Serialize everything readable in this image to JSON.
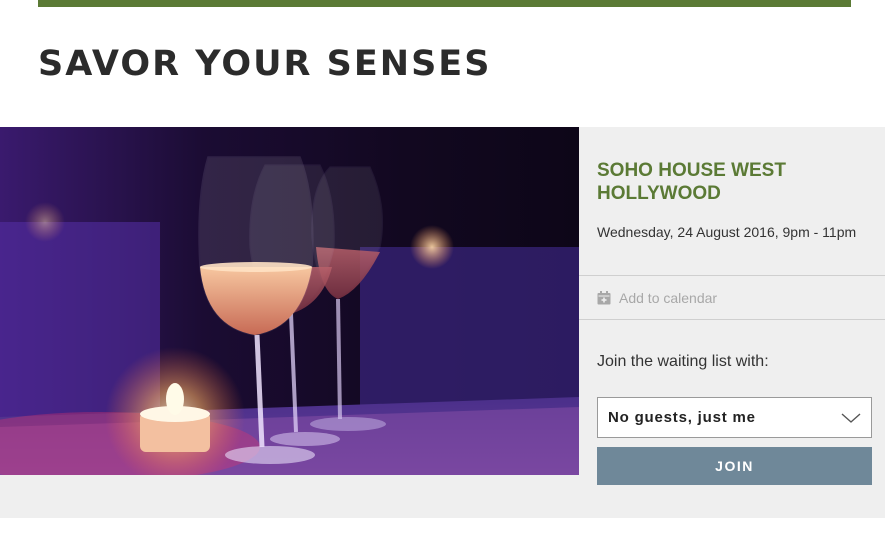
{
  "page": {
    "title": "SAVOR YOUR SENSES"
  },
  "event": {
    "image_alt": "Three wine glasses with rosé on a table beside a lit candle",
    "venue": "SOHO HOUSE WEST HOLLYWOOD",
    "datetime": "Wednesday, 24 August 2016, 9pm - 11pm",
    "add_to_calendar": "Add to calendar",
    "waiting_list_label": "Join the waiting list with:",
    "guest_select": {
      "value": "No guests, just me"
    },
    "join_label": "JOIN"
  },
  "colors": {
    "accent_green": "#5b7a35",
    "join_button": "#6f8899",
    "panel_bg": "#efefef"
  },
  "icons": {
    "calendar": "calendar-plus-icon",
    "dropdown": "chevron-down-icon"
  }
}
